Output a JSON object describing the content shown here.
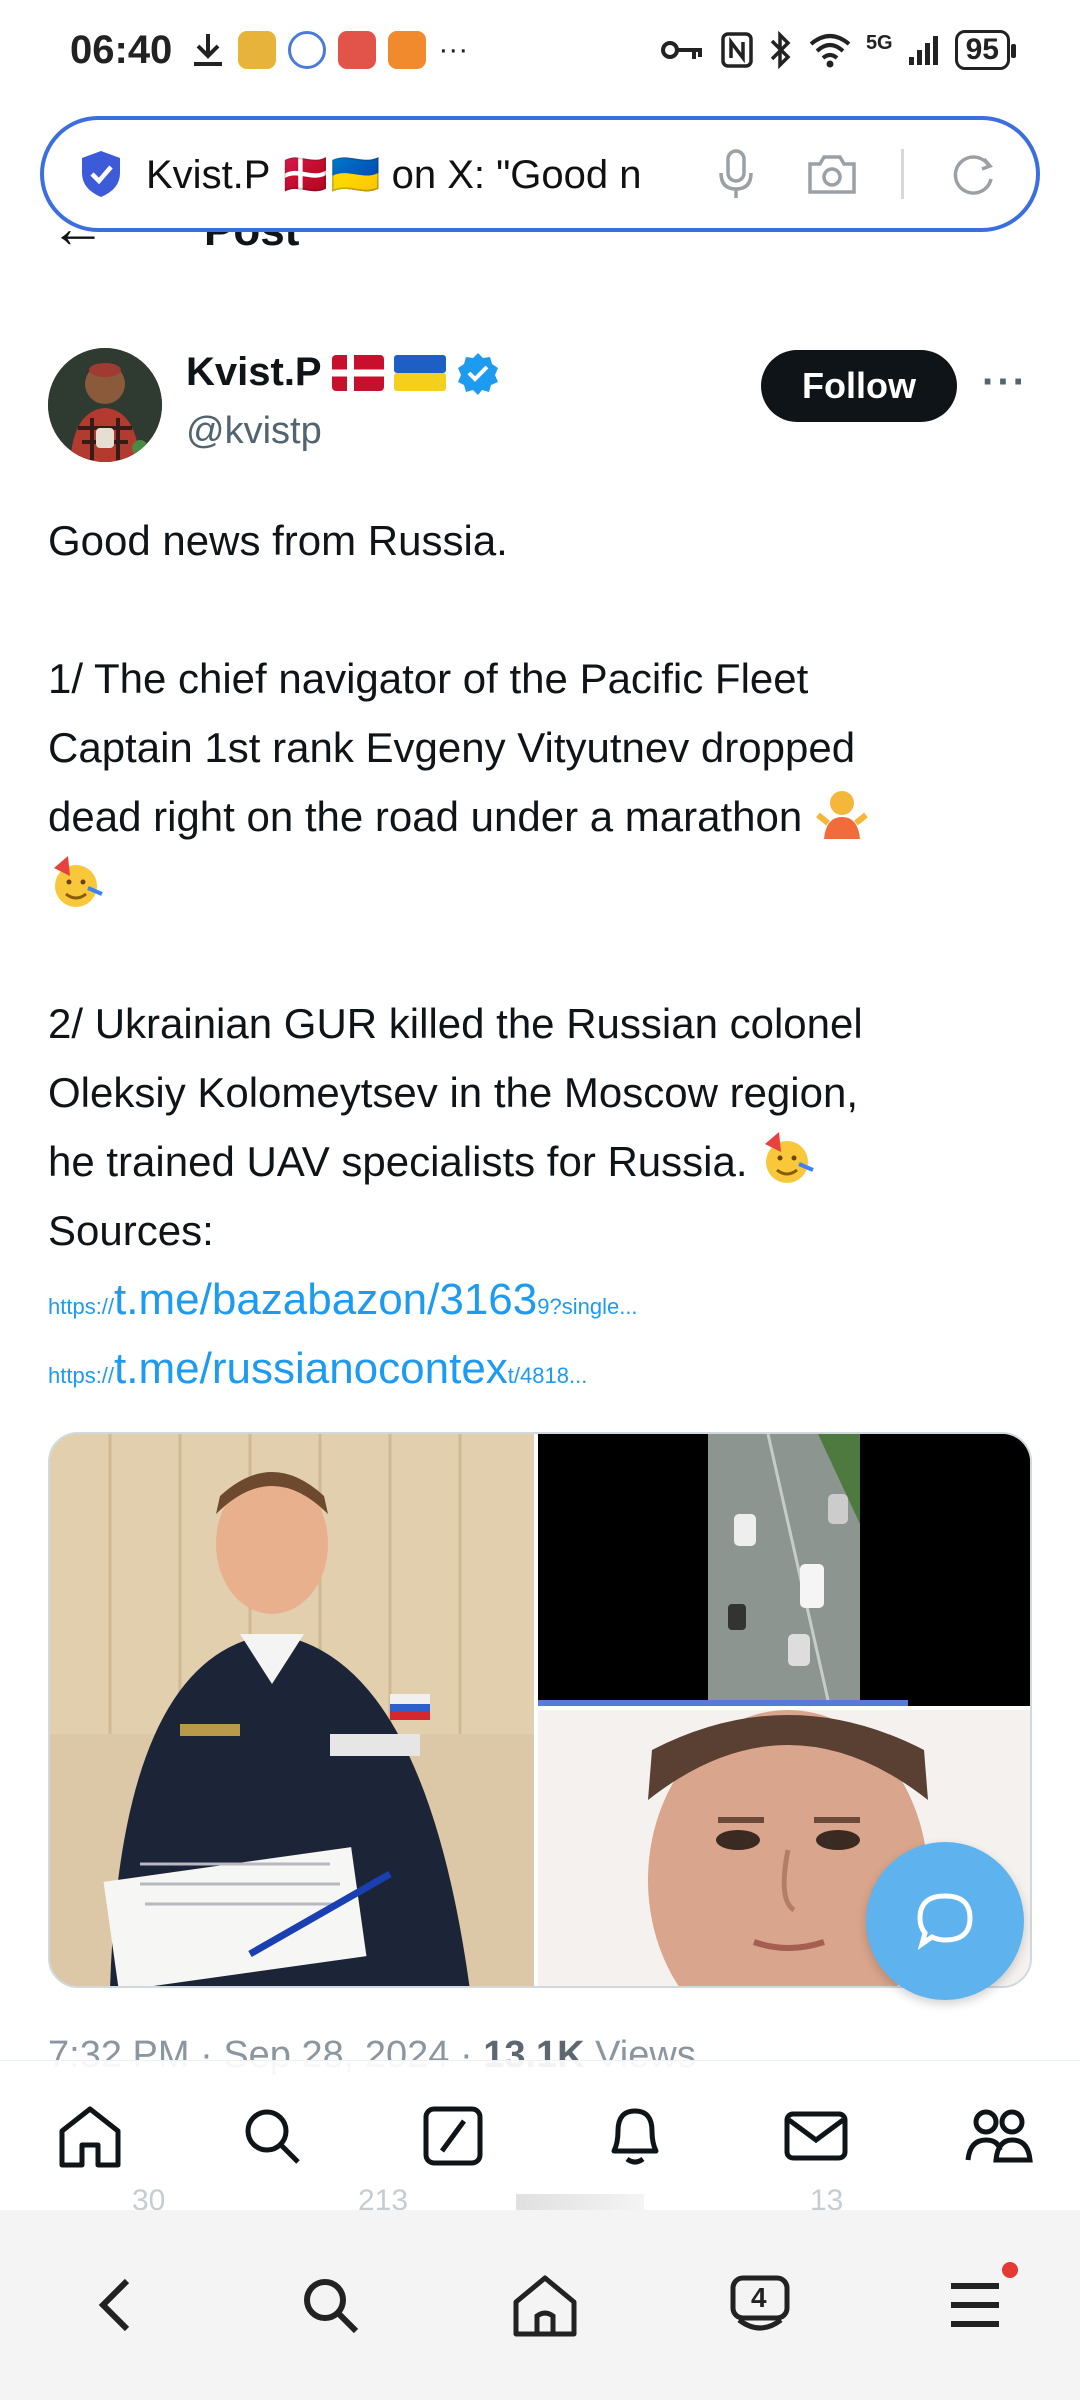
{
  "status_bar": {
    "time": "06:40",
    "more": "···",
    "network": "5G",
    "battery": "95"
  },
  "address_bar": {
    "text": "Kvist.P 🇩🇰🇺🇦 on X: \"Good n"
  },
  "header": {
    "back": "←",
    "title": "Post"
  },
  "author": {
    "name": "Kvist.P",
    "handle": "@kvistp",
    "follow_label": "Follow",
    "more": "···"
  },
  "tweet": {
    "line1": "Good news from Russia.",
    "line2": "1/ The chief navigator of the Pacific Fleet",
    "line3": "Captain 1st rank Evgeny Vityutnev dropped",
    "line4": "dead right on the road under a marathon",
    "line5": "2/ Ukrainian GUR killed the Russian colonel",
    "line6": "Oleksiy Kolomeytsev in the Moscow region,",
    "line7": "he trained UAV specialists for Russia.",
    "line8": "Sources:",
    "link1_prefix": "https://",
    "link1_main": "t.me/bazabazon/3163",
    "link1_suffix": "9?single...",
    "link2_prefix": "https://",
    "link2_main": "t.me/russianocontex",
    "link2_suffix": "t/4818..."
  },
  "meta": {
    "time": "7:32 PM",
    "sep1": " · ",
    "date": "Sep 28, 2024",
    "sep2": " · ",
    "views_count": "13.1K",
    "views_label": " Views"
  },
  "actions": {
    "replies": "30",
    "reposts": "213",
    "bookmarks": "13"
  },
  "browser_bar": {
    "tabs_count": "4"
  },
  "colors": {
    "accent": "#1d9bf0",
    "address_border": "#3b6fe0",
    "fab": "#5eb3ee",
    "text": "#0f1419",
    "muted": "#536471"
  }
}
